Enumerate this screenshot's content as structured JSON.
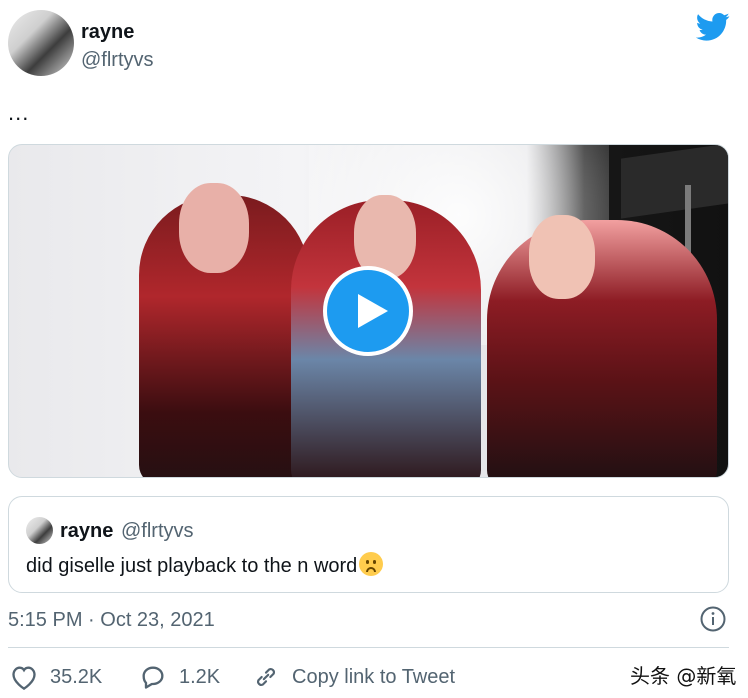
{
  "author": {
    "name": "rayne",
    "handle": "@flrtyvs"
  },
  "tweet": {
    "text": "..."
  },
  "media": {
    "type": "video",
    "play_icon": "play-icon"
  },
  "quote": {
    "name": "rayne",
    "handle": "@flrtyvs",
    "text": "did giselle just playback to the n word",
    "emoji": "worried-face"
  },
  "meta": {
    "timestamp": "5:15 PM · Oct 23, 2021",
    "info_icon": "info-icon"
  },
  "actions": {
    "likes": "35.2K",
    "replies": "1.2K",
    "copy_link_label": "Copy link to Tweet"
  },
  "watermark": "头条 @新氧",
  "colors": {
    "accent": "#1d9bf0",
    "secondary_text": "#536471",
    "border": "#cfd9de"
  }
}
